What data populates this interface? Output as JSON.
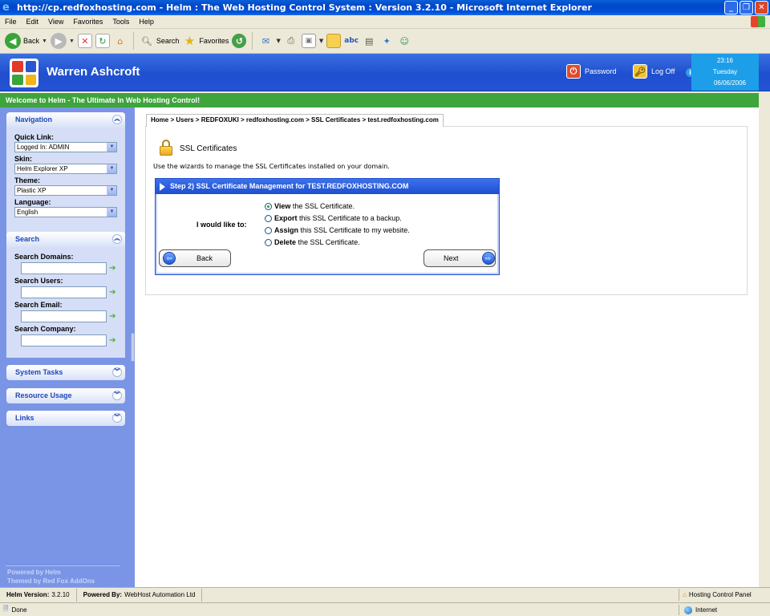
{
  "window": {
    "title": "http://cp.redfoxhosting.com - Helm : The Web Hosting Control System : Version 3.2.10 - Microsoft Internet Explorer",
    "controls": [
      "minimize",
      "maximize",
      "close"
    ]
  },
  "menu": [
    "File",
    "Edit",
    "View",
    "Favorites",
    "Tools",
    "Help"
  ],
  "toolbar": {
    "back_label": "Back",
    "search_label": "Search",
    "favorites_label": "Favorites"
  },
  "header": {
    "user_name": "Warren Ashcroft",
    "password_label": "Password",
    "logoff_label": "Log Off",
    "time": "23:16",
    "day": "Tuesday",
    "date": "06/06/2006"
  },
  "welcome_text": "Welcome to Helm - The Ultimate In Web Hosting Control!",
  "sidebar": {
    "navigation": {
      "title": "Navigation",
      "quick_link_label": "Quick Link:",
      "quick_link_value": "Logged In: ADMIN",
      "skin_label": "Skin:",
      "skin_value": "Helm Explorer XP",
      "theme_label": "Theme:",
      "theme_value": "Plastic XP",
      "language_label": "Language:",
      "language_value": "English"
    },
    "search": {
      "title": "Search",
      "domains_label": "Search Domains:",
      "users_label": "Search Users:",
      "email_label": "Search Email:",
      "company_label": "Search Company:"
    },
    "system_tasks": "System Tasks",
    "resource_usage": "Resource Usage",
    "links": "Links",
    "footer_line1": "Powered by Helm",
    "footer_line2": "Themed by Red Fox AddOns"
  },
  "breadcrumb": "Home > Users > REDFOXUKI > redfoxhosting.com > SSL Certificates > test.redfoxhosting.com",
  "page": {
    "title": "SSL Certificates",
    "description": "Use the wizards to manage the SSL Certificates installed on your domain."
  },
  "wizard": {
    "heading": "Step 2) SSL Certificate Management for TEST.REDFOXHOSTING.COM",
    "prompt": "I would like to:",
    "options": [
      {
        "bold": "View",
        "rest": " the SSL Certificate.",
        "selected": true
      },
      {
        "bold": "Export",
        "rest": " this SSL Certificate to a backup.",
        "selected": false
      },
      {
        "bold": "Assign",
        "rest": " this SSL Certificate to my website.",
        "selected": false
      },
      {
        "bold": "Delete",
        "rest": " the SSL Certificate.",
        "selected": false
      }
    ],
    "back_label": "Back",
    "next_label": "Next"
  },
  "footer": {
    "version_label": "Helm Version:",
    "version_value": "3.2.10",
    "powered_label": "Powered By:",
    "powered_value": "WebHost Automation Ltd",
    "panel_label": "Hosting Control Panel"
  },
  "status": {
    "text": "Done",
    "zone": "Internet"
  }
}
